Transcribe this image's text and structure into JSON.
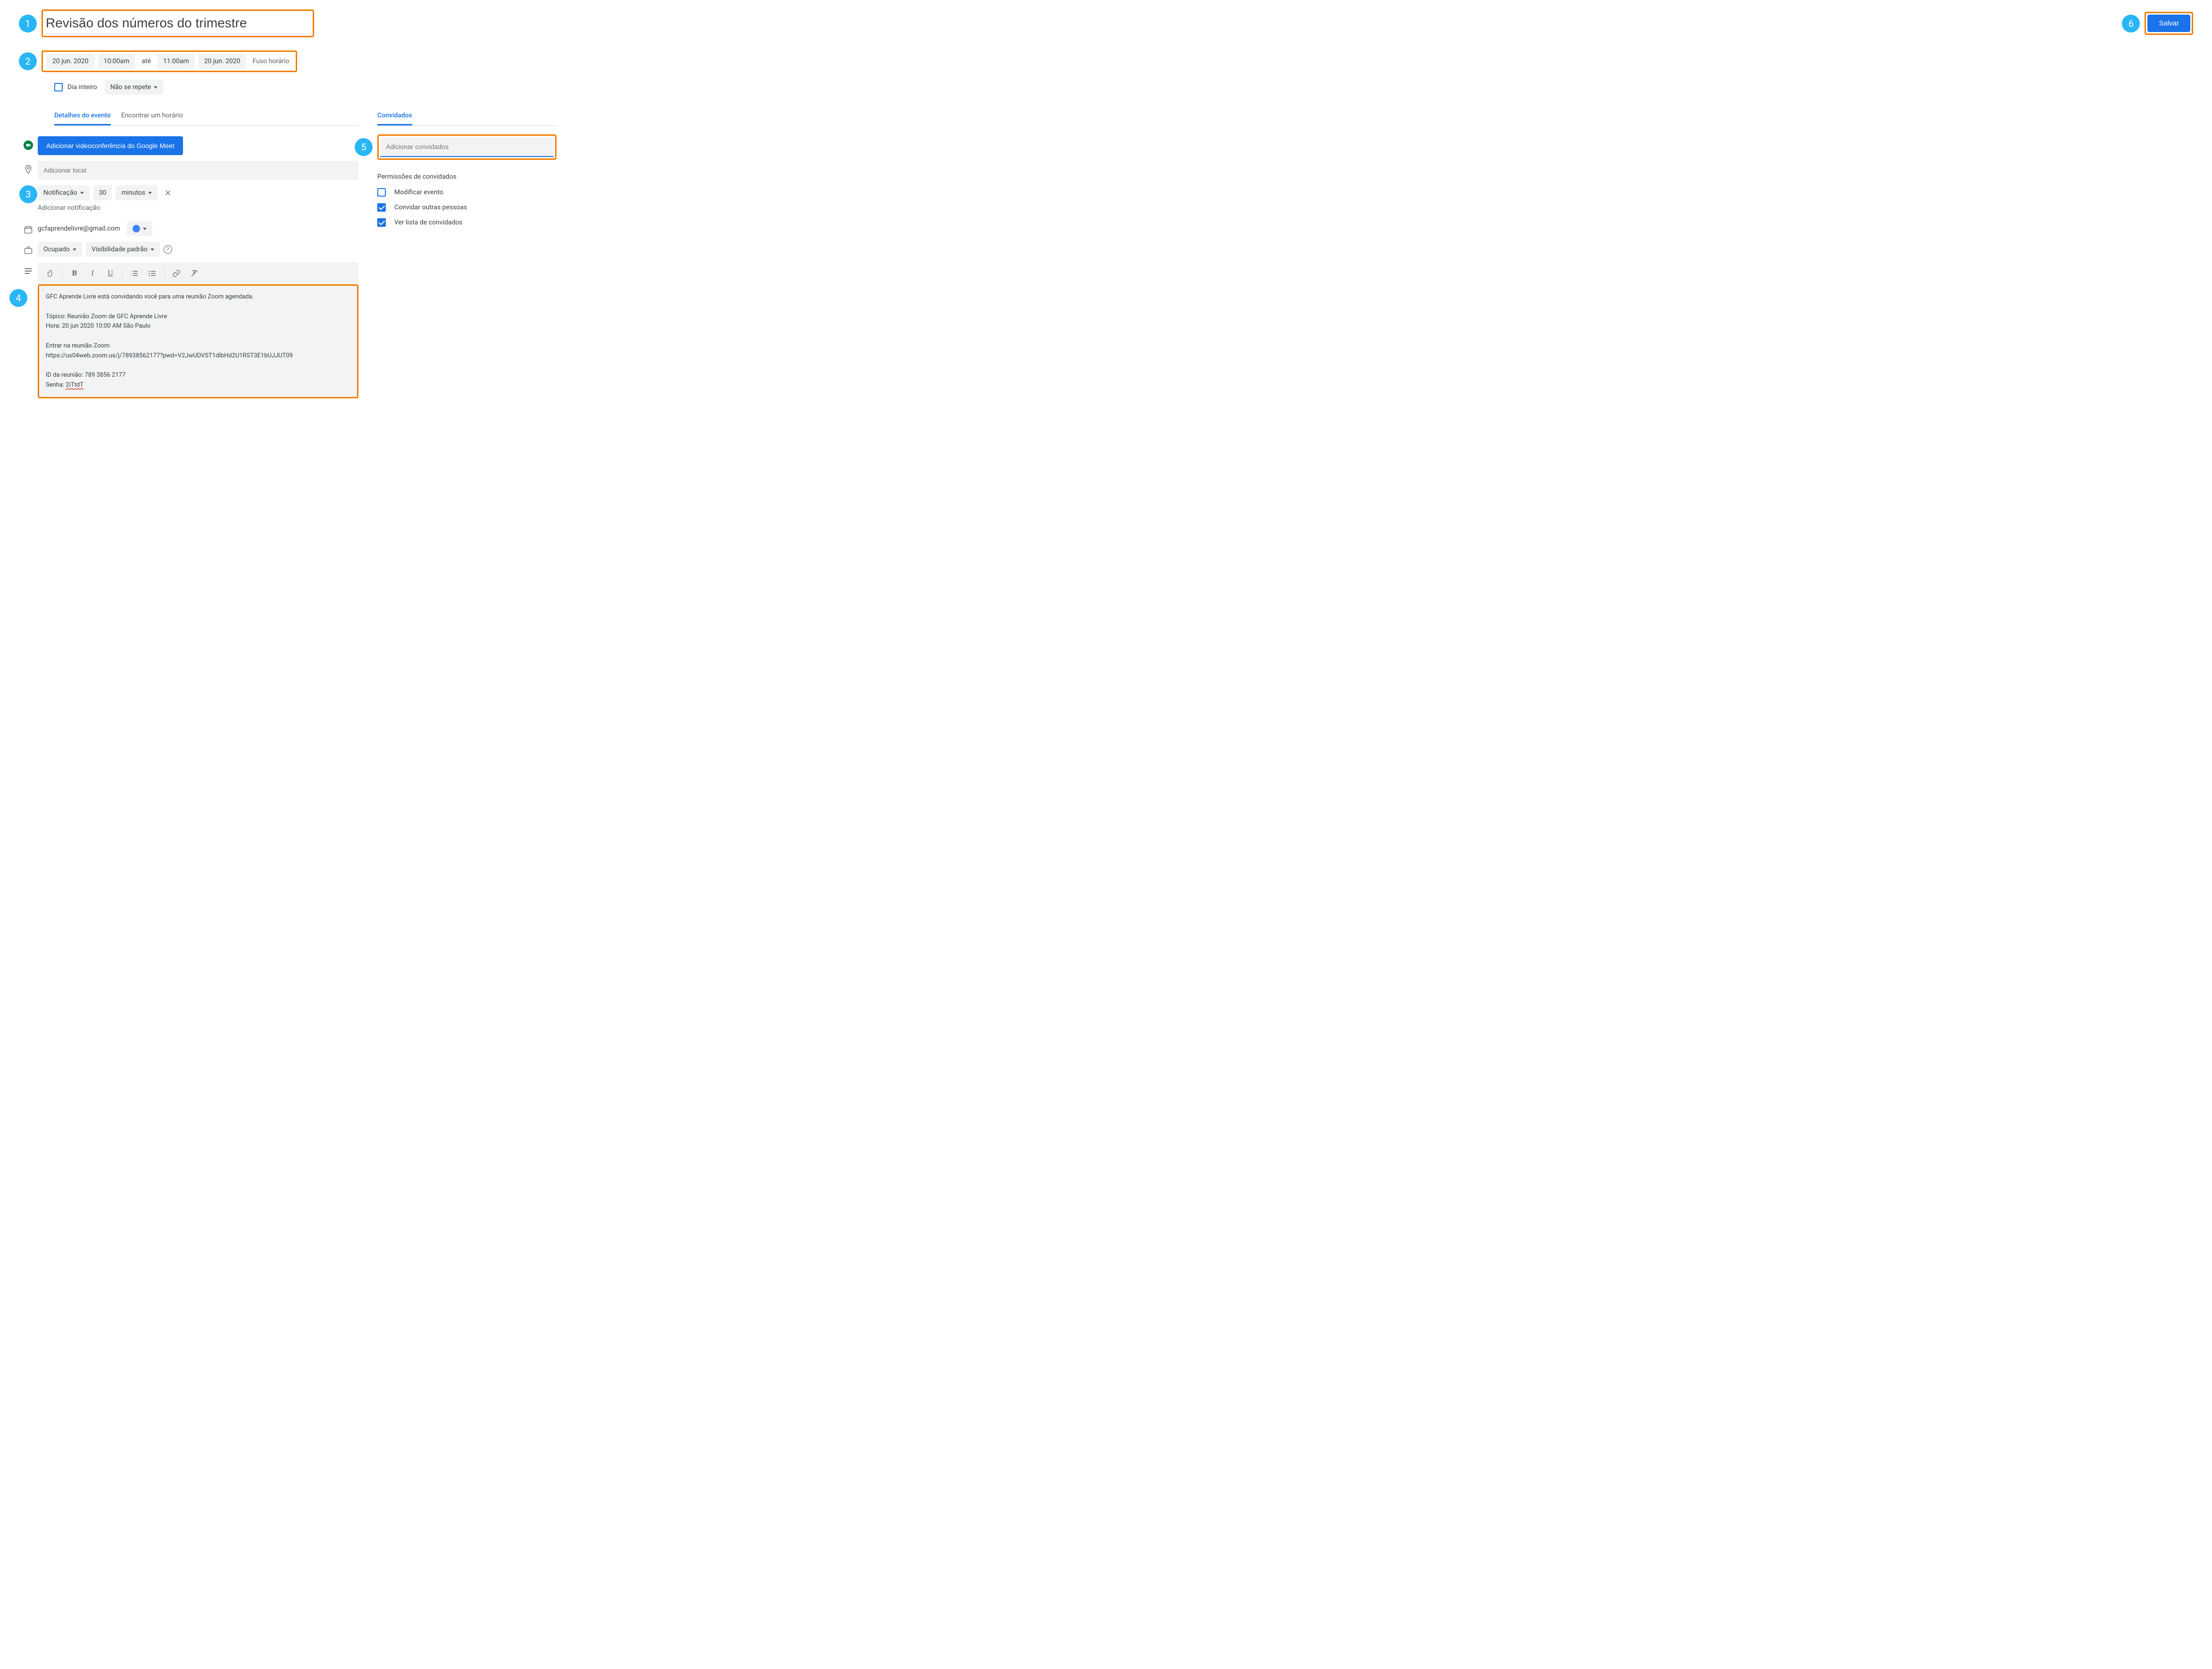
{
  "callouts": {
    "b1": "1",
    "b2": "2",
    "b3": "3",
    "b4": "4",
    "b5": "5",
    "b6": "6"
  },
  "title": "Revisão dos números do trimestre",
  "save": "Salvar",
  "datetime": {
    "start_date": "20 jun. 2020",
    "start_time": "10:00am",
    "to": "até",
    "end_time": "11:00am",
    "end_date": "20 jun. 2020",
    "timezone": "Fuso horário"
  },
  "allday": {
    "label": "Dia inteiro",
    "recurrence": "Não se repete"
  },
  "tabs": {
    "details": "Detalhes do evento",
    "find_time": "Encontrar um horário"
  },
  "meet_btn": "Adicionar videoconferência do Google Meet",
  "location_placeholder": "Adicionar local",
  "notification": {
    "type": "Notificação",
    "value": "30",
    "unit": "minutos",
    "add": "Adicionar notificação"
  },
  "calendar": {
    "owner": "gcfaprendelivre@gmail.com"
  },
  "availability": {
    "status": "Ocupado",
    "visibility": "Visibilidade padrão"
  },
  "description": {
    "l1": "GFC Aprende Livre está convidando você para uma reunião Zoom agendada.",
    "l2": "Tópico: Reunião Zoom de GFC Aprende Livre",
    "l3": "Hora: 20 jun 2020 10:00 AM São Paulo",
    "l4": "Entrar na reunião Zoom",
    "l5": "https://us04web.zoom.us/j/78938562177?pwd=V2JwUDVST1dlbHd2U1RST3E1bUJJUT09",
    "l6": "ID da reunião: 789 3856 2177",
    "l7a": "Senha: ",
    "l7b": "2iTtdT"
  },
  "guests": {
    "tab": "Convidados",
    "placeholder": "Adicionar convidados",
    "perm_title": "Permissões de convidados",
    "modify": "Modificar evento",
    "invite": "Convidar outras pessoas",
    "see_list": "Ver lista de convidados"
  }
}
